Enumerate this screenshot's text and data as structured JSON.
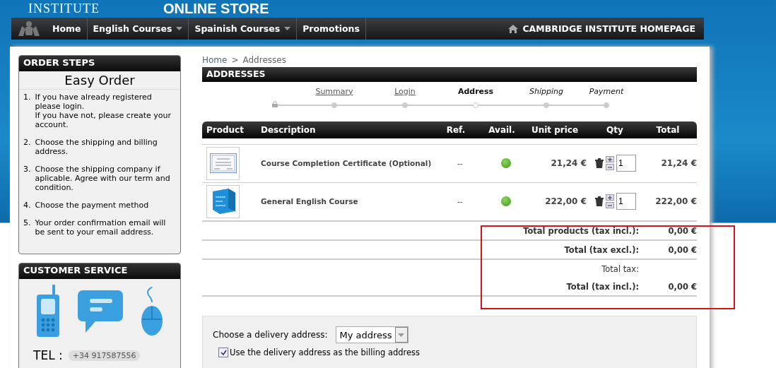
{
  "header": {
    "logo_text": "INSTITUTE",
    "title": "ONLINE STORE"
  },
  "nav": {
    "items": [
      {
        "label": "Home",
        "dropdown": false
      },
      {
        "label": "English Courses",
        "dropdown": true
      },
      {
        "label": "Spainish Courses",
        "dropdown": true
      },
      {
        "label": "Promotions",
        "dropdown": false
      }
    ],
    "homepage_link": "CAMBRIDGE INSTITUTE HOMEPAGE"
  },
  "order_steps": {
    "title": "ORDER STEPS",
    "heading": "Easy Order",
    "steps": [
      {
        "number": "1.",
        "lines": [
          "If you have already registered please login.",
          "If you have not, please create your account."
        ]
      },
      {
        "number": "2.",
        "lines": [
          "Choose the shipping and billing address."
        ]
      },
      {
        "number": "3.",
        "lines": [
          "Choose the shipping company if aplicable.  Agree with our term and condition."
        ]
      },
      {
        "number": "4.",
        "lines": [
          "Choose the payment method"
        ]
      },
      {
        "number": "5.",
        "lines": [
          "Your order confirmation email will be sent to your email address."
        ]
      }
    ]
  },
  "customer_service": {
    "title": "CUSTOMER SERVICE",
    "tel_label": "TEL :",
    "phone": "+34 917587556"
  },
  "breadcrumb": {
    "items": [
      "Home",
      "Addresses"
    ],
    "separator": ">"
  },
  "section_title": "ADDRESSES",
  "checkout_steps": [
    {
      "label": "Summary",
      "kind": "done"
    },
    {
      "label": "Login",
      "kind": "done"
    },
    {
      "label": "Address",
      "kind": "current"
    },
    {
      "label": "Shipping",
      "kind": "upcoming"
    },
    {
      "label": "Payment",
      "kind": "upcoming"
    }
  ],
  "cart": {
    "columns": [
      "Product",
      "Description",
      "Ref.",
      "Avail.",
      "Unit price",
      "Qty",
      "Total"
    ],
    "rows": [
      {
        "description": "Course Completion Certificate (Optional)",
        "ref": "--",
        "available": true,
        "unit_price": "21,24 €",
        "qty": "1",
        "total": "21,24 €",
        "kind": "certificate"
      },
      {
        "description": "General English Course",
        "ref": "--",
        "available": true,
        "unit_price": "222,00 €",
        "qty": "1",
        "total": "222,00 €",
        "kind": "box"
      }
    ]
  },
  "totals": [
    {
      "label": "Total products (tax incl.):",
      "value": "0,00 €",
      "bold": true
    },
    {
      "label": "Total (tax excl.):",
      "value": "0,00 €",
      "bold": true
    },
    {
      "label": "Total tax:",
      "bold": false
    },
    {
      "label": "Total (tax incl.):",
      "value": "0,00 €",
      "bold": true
    }
  ],
  "delivery": {
    "label": "Choose a delivery address:",
    "address": "My address",
    "billing": {
      "label": "Use the delivery address as the billing address",
      "checked": true
    }
  }
}
